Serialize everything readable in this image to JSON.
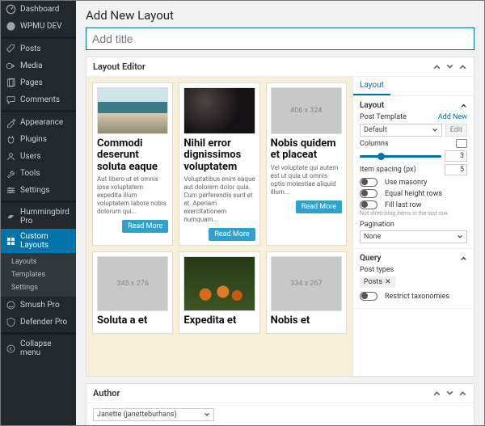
{
  "sidebar": {
    "items": [
      {
        "label": "Dashboard",
        "icon": "dashboard-icon"
      },
      {
        "label": "WPMU DEV",
        "icon": "wpmu-icon"
      },
      {
        "label": "Posts",
        "icon": "posts-icon"
      },
      {
        "label": "Media",
        "icon": "media-icon"
      },
      {
        "label": "Pages",
        "icon": "pages-icon"
      },
      {
        "label": "Comments",
        "icon": "comments-icon"
      },
      {
        "label": "Appearance",
        "icon": "appearance-icon"
      },
      {
        "label": "Plugins",
        "icon": "plugins-icon"
      },
      {
        "label": "Users",
        "icon": "users-icon"
      },
      {
        "label": "Tools",
        "icon": "tools-icon"
      },
      {
        "label": "Settings",
        "icon": "settings-icon"
      },
      {
        "label": "Hummingbird Pro",
        "icon": "hummingbird-icon"
      },
      {
        "label": "Custom Layouts",
        "icon": "layouts-icon",
        "active": true
      },
      {
        "label": "Smush Pro",
        "icon": "smush-icon"
      },
      {
        "label": "Defender Pro",
        "icon": "defender-icon"
      },
      {
        "label": "Collapse menu",
        "icon": "collapse-icon"
      }
    ],
    "submenu": [
      "Layouts",
      "Templates",
      "Settings"
    ]
  },
  "page": {
    "heading": "Add New Layout",
    "title_placeholder": "Add title"
  },
  "editor": {
    "panel_title": "Layout Editor",
    "read_more": "Read More",
    "cards": [
      {
        "image": "img-beach",
        "placeholder": "",
        "title": "Commodi deserunt soluta eaque",
        "excerpt": "Aut libero ut et omnis ipsa voluptatem expedita illum voluptatem labore nobis dolorum qui..."
      },
      {
        "image": "img-night",
        "placeholder": "",
        "title": "Nihil error dignissimos voluptatem",
        "excerpt": "Voluptatibus enim eaque aut dolorem dolor quia. Cum perferendis sunt et et. Aperiam exercitationem numquam..."
      },
      {
        "image": "",
        "placeholder": "406 x 324",
        "title": "Nobis quidem et placeat",
        "excerpt": "Vel voluptate qui autem est ut quia ut omnis optio molestiae aliquid illum..."
      },
      {
        "image": "",
        "placeholder": "345 x 276",
        "title": "Soluta a et",
        "excerpt": ""
      },
      {
        "image": "img-flowers",
        "placeholder": "",
        "title": "Expedita et",
        "excerpt": ""
      },
      {
        "image": "",
        "placeholder": "334 x 267",
        "title": "Nobis et",
        "excerpt": ""
      }
    ]
  },
  "settings": {
    "tab_label": "Layout",
    "section_layout": "Layout",
    "post_template_label": "Post Template",
    "add_new": "Add New",
    "post_template_value": "Default",
    "edit_label": "Edit",
    "columns_label": "Columns",
    "columns_value": "3",
    "item_spacing_label": "Item spacing (px)",
    "item_spacing_value": "5",
    "use_masonry": "Use masonry",
    "equal_rows": "Equal height rows",
    "fill_last_row": "Fill last row",
    "fill_hint": "Not stretching items in the last row.",
    "pagination_label": "Pagination",
    "pagination_value": "None",
    "section_query": "Query",
    "post_types_label": "Post types",
    "post_types_chip": "Posts",
    "restrict_tax": "Restrict taxonomies"
  },
  "author": {
    "panel_title": "Author",
    "value": "Janette (janetteburhans)"
  }
}
